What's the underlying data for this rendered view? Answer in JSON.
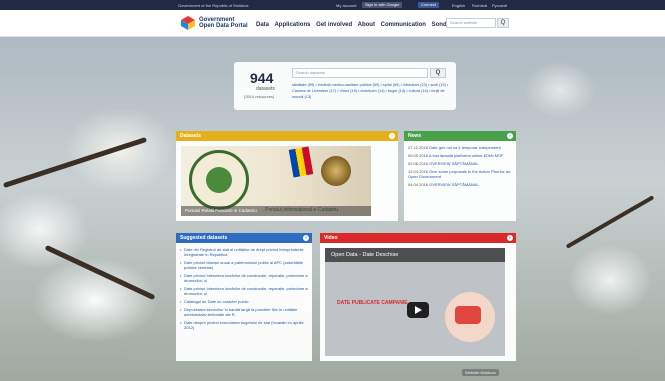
{
  "topbar": {
    "gov_link": "Government of the Republic of Moldova",
    "my_account": "My account",
    "sign_in_google": "Sign in with Google",
    "connect": "Connect",
    "languages": [
      "English",
      "Română",
      "Русский"
    ]
  },
  "header": {
    "logo_line1": "Government",
    "logo_line2": "Open Data Portal",
    "nav": [
      "Data",
      "Applications",
      "Get involved",
      "About",
      "Communication",
      "Sondaje"
    ],
    "search_placeholder": "Search website",
    "search_button": "Q"
  },
  "summary": {
    "count": "944",
    "count_label": "datasets",
    "resources": "(3514 resources)",
    "search_placeholder": "Search datasets",
    "search_button": "Q",
    "tags": "sănătate (99) • instituții medico-sanitare publice (59) • spital (55) • infracțiuni (23) • școli (15) • Camera de Licențiere (17) • Vinuri (15) • checkuen (14) • buget (14) • cultură (14) • fonjit de muncă (13)"
  },
  "datasets": {
    "title": "Datasets",
    "caption": "Portalul Relatii Funciare si Cadastru",
    "caption2": "Portalul informațional e-Cadastru"
  },
  "news": {
    "title": "News",
    "items": [
      {
        "date": "27.12.2016",
        "text": "Date geo noi ca 4 temporar independent"
      },
      {
        "date": "09.09.2016",
        "text": "A fost lansată platforma online EDMI.MOF"
      },
      {
        "date": "02.06.2016",
        "text": "OVERVIEW SĂPTĂMÂNAL"
      },
      {
        "date": "12.04.2016",
        "text": "Give some proposals to the Action Plan for an Open Government"
      },
      {
        "date": "04.04.2016",
        "text": "OVERVIEW SĂPTĂMÂNAL"
      }
    ]
  },
  "suggested": {
    "title": "Suggested datasets",
    "items": [
      "Date din Registrul de stat al unităților de drept privind întreprinderile înregistrate în Republica",
      "Date privind bilanțul anual a patrimoniului public al APC (autoritățile publice centrale)",
      "Date privind înlesnirea lucrărilor de construcție, reparație, proiectare a drumurilor, și",
      "Date privind înlesnirea lucrărilor de construcție, reparație, proiectare a drumurilor, și",
      "Catalogul de Date cu caracter public",
      "Depozitarea serviciilor în bandă largă la punctele fixe în unitățile administrativ-teritoriale ale R.",
      "Date despre privind executarea bugetului de stat (încasări cu aprilie 2012)"
    ]
  },
  "video": {
    "title": "Video",
    "video_title": "Open Data - Date Deschise",
    "art_text": "DATE PUBLICATE CAMPANIE"
  },
  "footer": {
    "badge": "Website Moldova"
  }
}
